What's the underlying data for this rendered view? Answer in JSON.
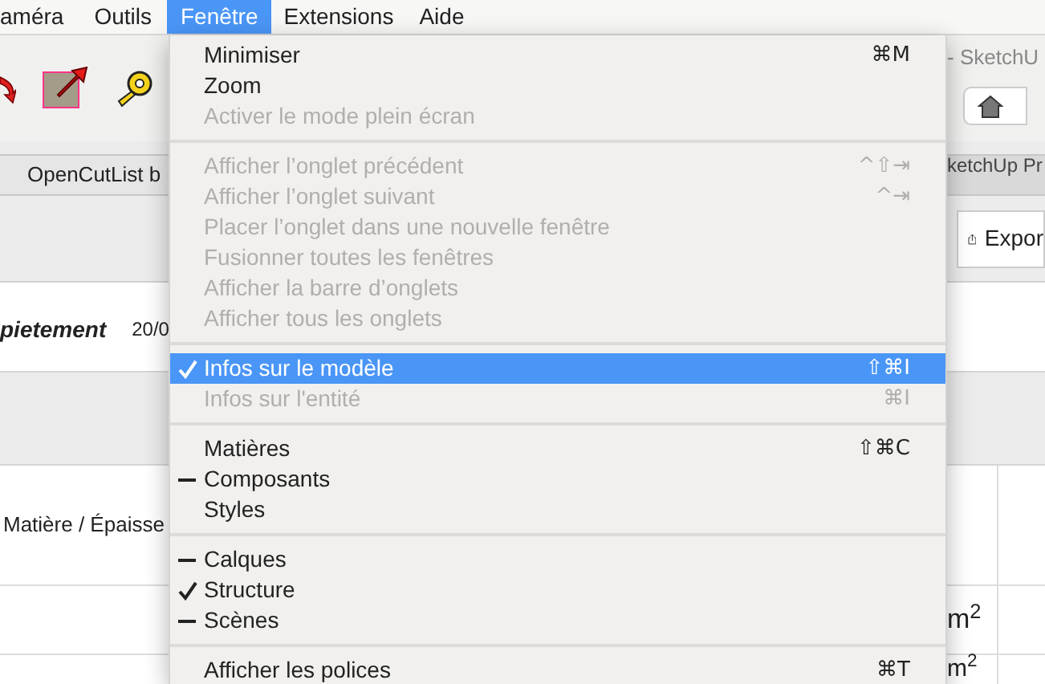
{
  "menu_bar": [
    {
      "label": "améra",
      "selected": false
    },
    {
      "label": "Outils",
      "selected": false
    },
    {
      "label": "Fenêtre",
      "selected": true
    },
    {
      "label": "Extensions",
      "selected": false
    },
    {
      "label": "Aide",
      "selected": false
    }
  ],
  "window_title": "- SketchU",
  "tabs": [
    "OpenCutList b",
    "ketchUp Pr"
  ],
  "export_button": "Expor",
  "header": {
    "title": "pietement",
    "date": "20/0"
  },
  "table": {
    "cell": "Matière / Épaisse",
    "values": [
      "m$^{2}$",
      "m$^{2}$"
    ]
  },
  "menu": [
    [
      {
        "label": "Minimiser",
        "shortcut": "⌘M",
        "disabled": false,
        "checked": false,
        "mixed": false,
        "selected": false
      },
      {
        "label": "Zoom",
        "disabled": false,
        "checked": false,
        "mixed": false,
        "selected": false
      },
      {
        "label": "Activer le mode plein écran",
        "disabled": true,
        "checked": false,
        "mixed": false,
        "selected": false
      }
    ],
    [
      {
        "label": "Afficher l’onglet précédent",
        "shortcut": "^⇧⇥",
        "disabled": true,
        "checked": false,
        "mixed": false,
        "selected": false
      },
      {
        "label": "Afficher l’onglet suivant",
        "shortcut": "^⇥",
        "disabled": true,
        "checked": false,
        "mixed": false,
        "selected": false
      },
      {
        "label": "Placer l’onglet dans une nouvelle fenêtre",
        "disabled": true,
        "checked": false,
        "mixed": false,
        "selected": false
      },
      {
        "label": "Fusionner toutes les fenêtres",
        "disabled": true,
        "checked": false,
        "mixed": false,
        "selected": false
      },
      {
        "label": "Afficher la barre d’onglets",
        "disabled": true,
        "checked": false,
        "mixed": false,
        "selected": false
      },
      {
        "label": "Afficher tous les onglets",
        "disabled": true,
        "checked": false,
        "mixed": false,
        "selected": false
      }
    ],
    [
      {
        "label": "Infos sur le modèle",
        "shortcut": "⇧⌘I",
        "disabled": false,
        "checked": true,
        "mixed": false,
        "selected": true
      },
      {
        "label": "Infos sur l'entité",
        "shortcut": "⌘I",
        "disabled": true,
        "checked": false,
        "mixed": false,
        "selected": false
      }
    ],
    [
      {
        "label": "Matières",
        "shortcut": "⇧⌘C",
        "disabled": false,
        "checked": false,
        "mixed": false,
        "selected": false
      },
      {
        "label": "Composants",
        "disabled": false,
        "checked": false,
        "mixed": true,
        "selected": false
      },
      {
        "label": "Styles",
        "disabled": false,
        "checked": false,
        "mixed": false,
        "selected": false
      }
    ],
    [
      {
        "label": "Calques",
        "disabled": false,
        "checked": false,
        "mixed": true,
        "selected": false
      },
      {
        "label": "Structure",
        "disabled": false,
        "checked": true,
        "mixed": false,
        "selected": false
      },
      {
        "label": "Scènes",
        "disabled": false,
        "checked": false,
        "mixed": true,
        "selected": false
      }
    ],
    [
      {
        "label": "Afficher les polices",
        "shortcut": "⌘T",
        "disabled": false,
        "checked": false,
        "mixed": false,
        "selected": false
      }
    ]
  ]
}
